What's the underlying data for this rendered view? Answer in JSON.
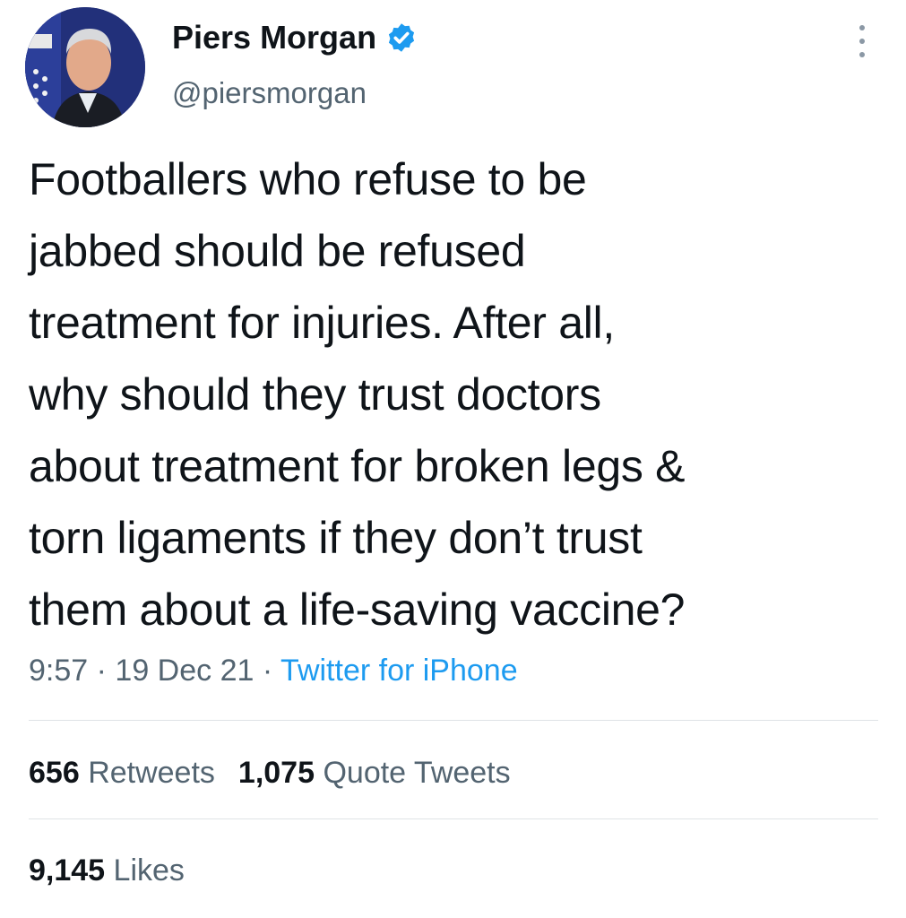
{
  "author": {
    "display_name": "Piers Morgan",
    "handle": "@piersmorgan",
    "verified": true,
    "avatar_icon": "profile-photo"
  },
  "tweet": {
    "lines": [
      "Footballers who refuse to be",
      "jabbed should be refused",
      "treatment for injuries. After all,",
      "why should they trust doctors",
      "about treatment for broken legs &",
      "torn ligaments if they don’t trust",
      "them about a life-saving vaccine?"
    ],
    "time": "9:57",
    "date": "19 Dec 21",
    "separator": "·",
    "source": "Twitter for iPhone"
  },
  "stats": {
    "retweets_count": "656",
    "retweets_label": "Retweets",
    "quotes_count": "1,075",
    "quotes_label": "Quote Tweets",
    "likes_count": "9,145",
    "likes_label": "Likes"
  },
  "colors": {
    "text": "#0f1419",
    "secondary": "#536471",
    "link": "#1d9bf0",
    "divider": "#dfe3e6"
  }
}
